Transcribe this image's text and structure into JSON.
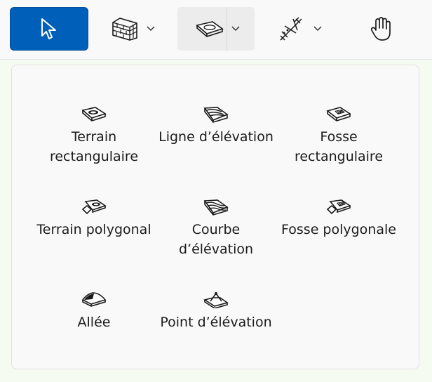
{
  "toolbar": {
    "select_tool": {
      "icon": "cursor-arrow-icon",
      "active": true,
      "accent": "#005fb8"
    },
    "wall_tool": {
      "icon": "brick-wall-icon"
    },
    "terrain_tool": {
      "icon": "terrain-slab-icon",
      "expanded": true
    },
    "trees_tool": {
      "icon": "plant-symbol-icon"
    },
    "pan_tool": {
      "icon": "hand-icon"
    }
  },
  "panel": {
    "items": [
      {
        "label": "Terrain rectangulaire",
        "icon": "rectangular-terrain-icon"
      },
      {
        "label": "Ligne d’élévation",
        "icon": "elevation-line-icon"
      },
      {
        "label": "Fosse rectangulaire",
        "icon": "rectangular-pit-icon"
      },
      {
        "label": "Terrain polygonal",
        "icon": "polygonal-terrain-icon"
      },
      {
        "label": "Courbe d’élévation",
        "icon": "elevation-curve-icon"
      },
      {
        "label": "Fosse polygonale",
        "icon": "polygonal-pit-icon"
      },
      {
        "label": "Allée",
        "icon": "driveway-icon"
      },
      {
        "label": "Point d’élévation",
        "icon": "elevation-point-icon"
      }
    ]
  }
}
